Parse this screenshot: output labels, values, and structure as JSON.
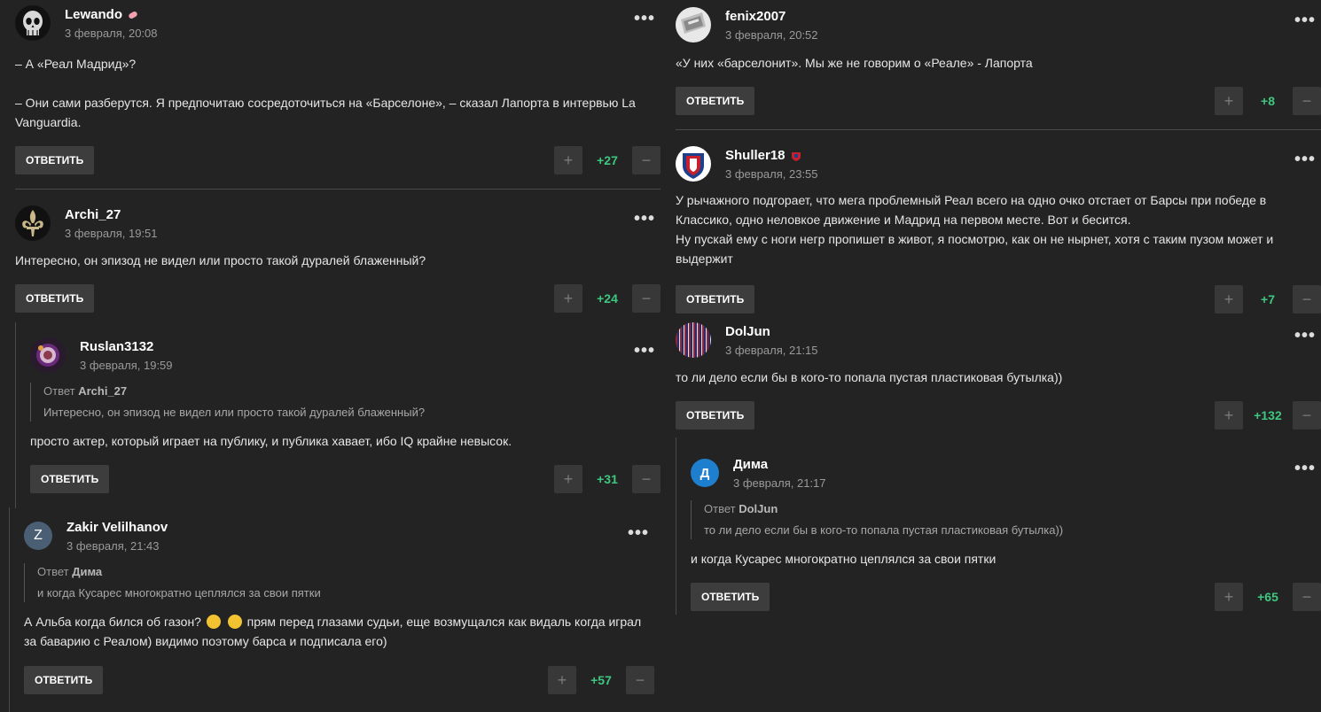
{
  "reply_label": "ОТВЕТИТЬ",
  "reply_prefix": "Ответ",
  "left": {
    "c1": {
      "author": "Lewando",
      "date": "3 февраля, 20:08",
      "text": "– А «Реал Мадрид»?\n\n– Они сами разберутся. Я предпочитаю сосредоточиться на «Барселоне», – сказал Лапорта в интервью La Vanguardia.",
      "score": "+27"
    },
    "c2": {
      "author": "Archi_27",
      "date": "3 февраля, 19:51",
      "text": "Интересно, он эпизод не видел или просто такой дуралей блаженный?",
      "score": "+24"
    },
    "c3": {
      "author": "Ruslan3132",
      "date": "3 февраля, 19:59",
      "quote_author": "Archi_27",
      "quote_text": "Интересно, он эпизод не видел или просто такой дуралей блаженный?",
      "text": "просто актер, который играет на публику, и публика хавает, ибо IQ крайне невысок.",
      "score": "+31"
    },
    "c4": {
      "author": "Zakir Velilhanov",
      "avatar_letter": "Z",
      "date": "3 февраля, 21:43",
      "quote_author": "Дима",
      "quote_text": "и когда Кусарес многократно цеплялся за свои пятки",
      "text_a": "А Альба когда бился об газон?",
      "text_b": " прям перед глазами судьи, еще возмущался как видаль когда играл за баварию с Реалом) видимо поэтому барса и подписала его)",
      "score": "+57"
    }
  },
  "right": {
    "c5": {
      "author": "fenix2007",
      "date": "3 февраля, 20:52",
      "text": "«У них «барселонит». Мы же не говорим о «Реале» - Лапорта",
      "score": "+8"
    },
    "c6": {
      "author": "Shuller18",
      "date": "3 февраля, 23:55",
      "text": "У рычажного подгорает, что мега проблемный Реал всего на одно очко отстает от Барсы при победе в Классико, одно неловкое движение и Мадрид на первом месте. Вот и бесится.\nНу пускай ему с ноги негр пропишет в живот, я посмотрю, как он не нырнет, хотя с таким пузом может и выдержит",
      "score": "+7"
    },
    "c7": {
      "author": "DolJun",
      "date": "3 февраля, 21:15",
      "text": "то ли дело если бы в кого-то попала пустая пластиковая бутылка))",
      "score": "+132"
    },
    "c8": {
      "author": "Дима",
      "avatar_letter": "Д",
      "date": "3 февраля, 21:17",
      "quote_author": "DolJun",
      "quote_text": "то ли дело если бы в кого-то попала пустая пластиковая бутылка))",
      "text": "и когда Кусарес многократно цеплялся за свои пятки",
      "score": "+65"
    }
  },
  "colors": {
    "background": "#232323",
    "score": "#3ec780",
    "button": "#3d3d3d",
    "zakir_avatar": "#4a5f73",
    "dima_avatar": "#1f7fcf"
  }
}
